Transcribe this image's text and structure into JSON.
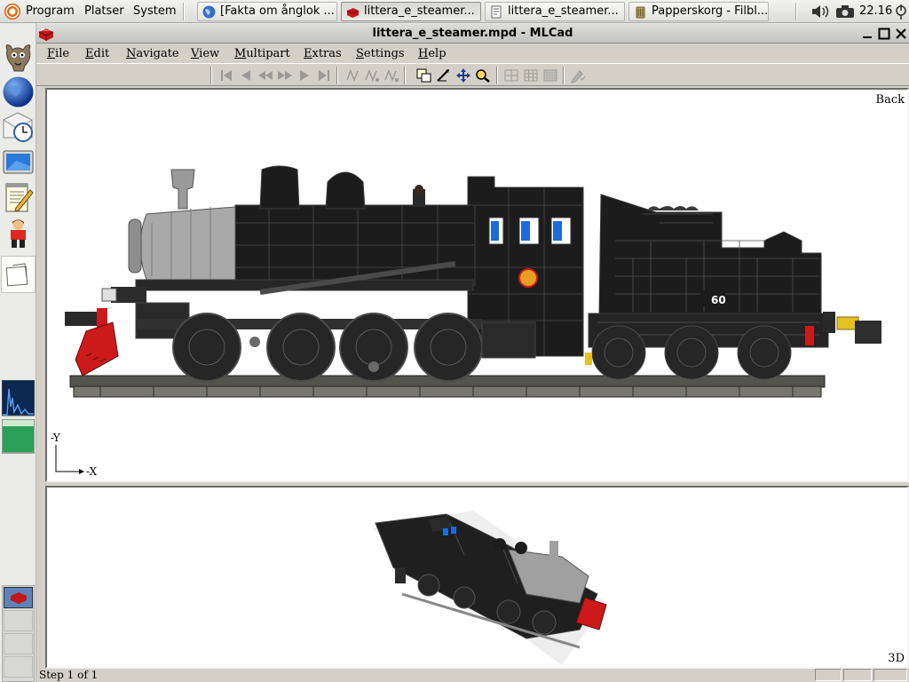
{
  "top_panel": {
    "menus": [
      "Program",
      "Platser",
      "System"
    ],
    "taskbar": [
      {
        "label": "[Fakta om ånglok ...",
        "icon": "globe-icon",
        "active": false
      },
      {
        "label": "littera_e_steamer...",
        "icon": "lego-brick-icon",
        "active": true
      },
      {
        "label": "littera_e_steamer...",
        "icon": "text-editor-icon",
        "active": false
      },
      {
        "label": "Papperskorg - Filbl...",
        "icon": "trash-icon",
        "active": false
      }
    ],
    "clock": "22.16"
  },
  "window": {
    "title": "littera_e_steamer.mpd - MLCad",
    "menu": [
      "File",
      "Edit",
      "Navigate",
      "View",
      "Multipart",
      "Extras",
      "Settings",
      "Help"
    ]
  },
  "views": {
    "top_label": "Back",
    "axis_y": "-Y",
    "axis_x": "-X",
    "bottom_label": "3D",
    "tender_number": "60"
  },
  "status": {
    "text": "Step 1 of 1"
  },
  "colors": {
    "accent_red": "#cc1a1a",
    "loco_black": "#1c1c1c",
    "boiler_grey": "#9a9a9a",
    "window_blue": "#1c6cd8"
  }
}
